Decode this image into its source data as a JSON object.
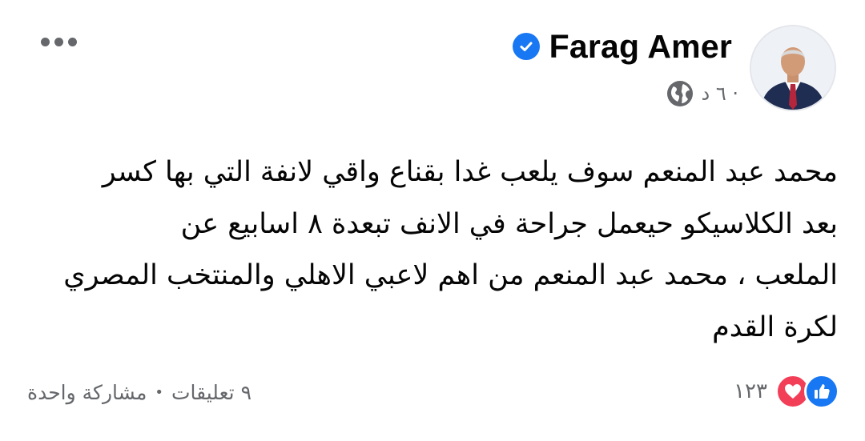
{
  "post": {
    "author": "Farag Amer",
    "verified": true,
    "timestamp": "٦ د ·",
    "audience_icon": "globe-icon",
    "text_lines": [
      "محمد عبد المنعم سوف يلعب غدا بقناع واقي لانفة التي بها كسر",
      "بعد الكلاسيكو حيعمل جراحة في الانف تبعدة ٨ اسابيع عن",
      "الملعب ، محمد عبد المنعم من اهم لاعبي الاهلي والمنتخب المصري",
      "لكرة القدم"
    ],
    "reactions": {
      "types": [
        "like-icon",
        "love-icon"
      ],
      "count": "١٢٣"
    },
    "comments": "٩ تعليقات",
    "separator": "•",
    "shares": "مشاركة واحدة"
  },
  "colors": {
    "primary_text": "#050505",
    "secondary_text": "#65676b",
    "accent_blue": "#1877f2",
    "love_red": "#f33e58"
  }
}
